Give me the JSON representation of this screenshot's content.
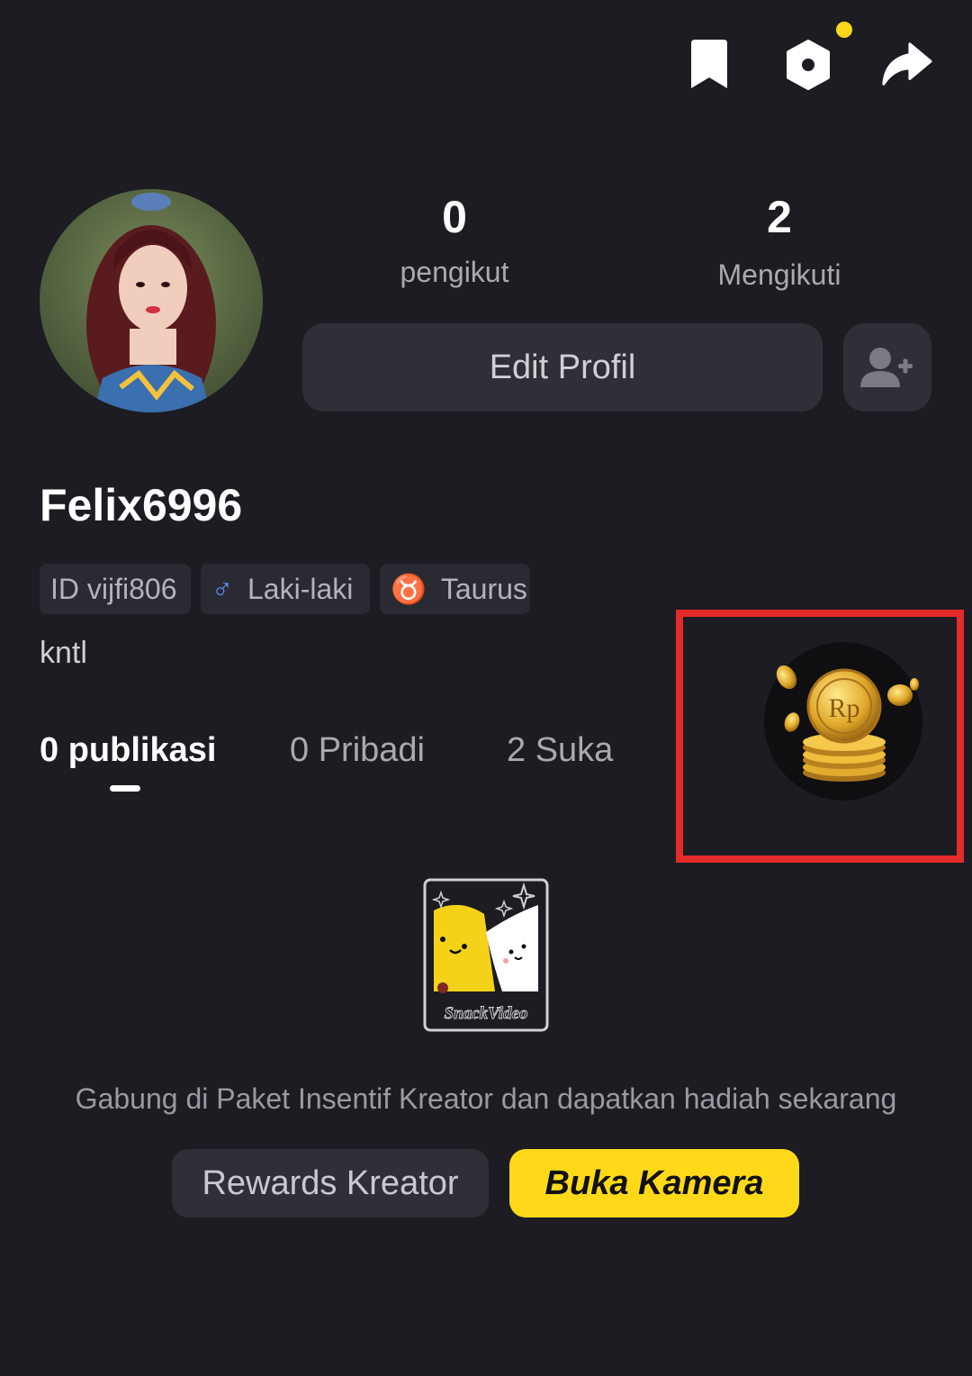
{
  "profile": {
    "username": "Felix6996",
    "bio": "kntl",
    "followers_count": "0",
    "followers_label": "pengikut",
    "following_count": "2",
    "following_label": "Mengikuti",
    "edit_button": "Edit Profil"
  },
  "tags": {
    "id": "ID vijfi806",
    "gender": "Laki-laki",
    "zodiac": "Taurus"
  },
  "tabs": {
    "publikasi": "0 publikasi",
    "pribadi": "0 Pribadi",
    "suka": "2 Suka"
  },
  "promo": {
    "text": "Gabung di Paket Insentif Kreator dan dapatkan hadiah sekarang",
    "rewards_button": "Rewards Kreator",
    "camera_button": "Buka Kamera",
    "logo_text": "SnackVideo"
  },
  "coin": {
    "label": "Rp"
  },
  "icons": [
    "bookmark-icon",
    "settings-hex-icon",
    "share-icon",
    "add-user-icon",
    "male-icon",
    "taurus-icon",
    "coin-stack-icon"
  ],
  "colors": {
    "background": "#1c1c22",
    "accent_yellow": "#ffd919",
    "highlight_red": "#e52a2a",
    "tag_blue": "#5f8cff"
  }
}
